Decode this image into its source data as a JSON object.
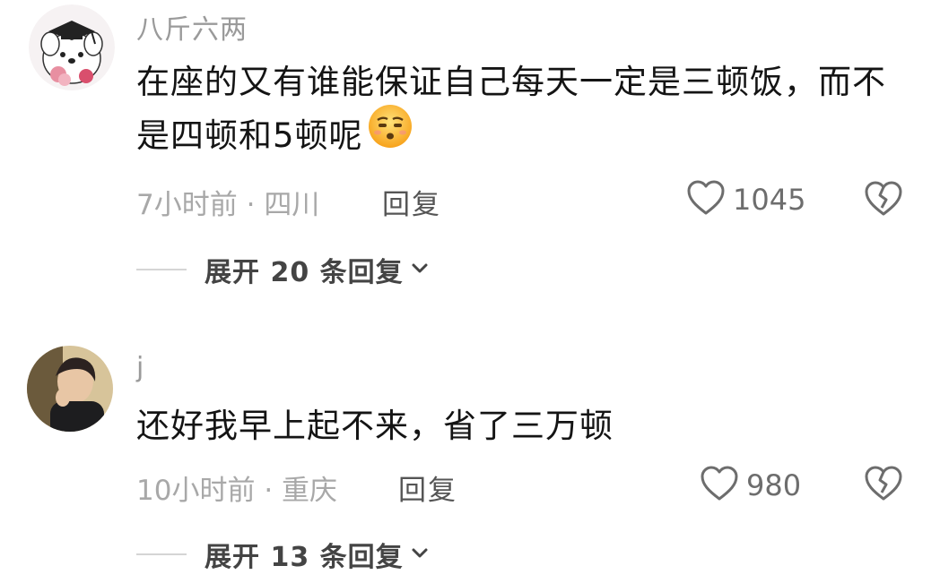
{
  "comments": [
    {
      "username": "八斤六两",
      "text": "在座的又有谁能保证自己每天一定是三顿饭，而不是四顿和5顿呢",
      "emoji": "smirk-face-emoji",
      "time": "7小时前",
      "location": "四川",
      "reply_label": "回复",
      "likes": "1045",
      "expand_label": "展开 20 条回复"
    },
    {
      "username": "j",
      "text": "还好我早上起不来，省了三万顿",
      "time": "10小时前",
      "location": "重庆",
      "reply_label": "回复",
      "likes": "980",
      "expand_label": "展开 13 条回复"
    }
  ],
  "separator": "·",
  "colors": {
    "meta": "#a8a8a8",
    "text": "#141414",
    "icon": "#6d6d6d"
  }
}
